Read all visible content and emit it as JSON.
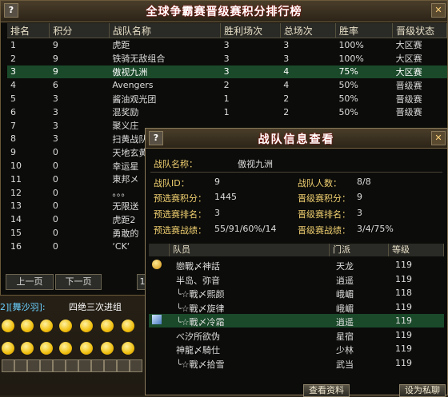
{
  "ranking": {
    "title": "全球争霸赛晋级赛积分排行榜",
    "headers": [
      "排名",
      "积分",
      "战队名称",
      "胜利场次",
      "总场次",
      "胜率",
      "晋级状态"
    ],
    "rows": [
      [
        "1",
        "9",
        "虎距",
        "3",
        "3",
        "100%",
        "大区赛"
      ],
      [
        "2",
        "9",
        "铁骑无敌组合",
        "3",
        "3",
        "100%",
        "大区赛"
      ],
      [
        "3",
        "9",
        "傲视九洲",
        "3",
        "4",
        "75%",
        "大区赛"
      ],
      [
        "4",
        "6",
        "Avengers",
        "2",
        "4",
        "50%",
        "晋级赛"
      ],
      [
        "5",
        "3",
        "酱油观光团",
        "1",
        "2",
        "50%",
        "晋级赛"
      ],
      [
        "6",
        "3",
        "混奖励",
        "1",
        "2",
        "50%",
        "晋级赛"
      ],
      [
        "7",
        "3",
        "聚义庄",
        "",
        "",
        "",
        ""
      ],
      [
        "8",
        "3",
        "扫黄战队",
        "",
        "",
        "",
        ""
      ],
      [
        "9",
        "0",
        "天地玄黄",
        "",
        "",
        "",
        ""
      ],
      [
        "10",
        "0",
        "幸运星",
        "",
        "",
        "",
        ""
      ],
      [
        "11",
        "0",
        "東邦メ",
        "",
        "",
        "",
        ""
      ],
      [
        "12",
        "0",
        "。。。",
        "",
        "",
        "",
        ""
      ],
      [
        "13",
        "0",
        "无限送",
        "",
        "",
        "",
        ""
      ],
      [
        "14",
        "0",
        "虎距2",
        "",
        "",
        "",
        ""
      ],
      [
        "15",
        "0",
        "勇敢的",
        "",
        "",
        "",
        ""
      ],
      [
        "16",
        "0",
        "‘CK‘",
        "",
        "",
        "",
        ""
      ]
    ],
    "selected_index": 2,
    "prev_label": "上一页",
    "next_label": "下一页",
    "page_stub": "1"
  },
  "chat": {
    "user": "2][舞沙羽]:",
    "text": "四绝三次进组"
  },
  "team": {
    "title": "战队信息查看",
    "name_label": "战队名称：",
    "name_value": "傲视九洲",
    "id_label": "战队ID：",
    "id_value": "9",
    "size_label": "战队人数：",
    "size_value": "8/8",
    "pre_score_label": "预选赛积分：",
    "pre_score_value": "1445",
    "promo_score_label": "晋级赛积分：",
    "promo_score_value": "9",
    "pre_rank_label": "预选赛排名：",
    "pre_rank_value": "3",
    "promo_rank_label": "晋级赛排名：",
    "promo_rank_value": "3",
    "pre_record_label": "预选赛战绩：",
    "pre_record_value": "55/91/60%/14",
    "promo_record_label": "晋级赛战绩：",
    "promo_record_value": "3/4/75%",
    "member_headers": [
      "队员",
      "门派",
      "等级"
    ],
    "members": [
      {
        "name": "戀戰〆神話",
        "sect": "天龙",
        "level": "119"
      },
      {
        "name": "半岛、弥音",
        "sect": "逍遥",
        "level": "119"
      },
      {
        "name": "╰☆戰〆熙颜",
        "sect": "峨嵋",
        "level": "118"
      },
      {
        "name": "╰☆戰〆旋律",
        "sect": "峨嵋",
        "level": "119"
      },
      {
        "name": "╰☆戰〆冷霜",
        "sect": "逍遥",
        "level": "119"
      },
      {
        "name": "べ汐所欲伪",
        "sect": "星宿",
        "level": "119"
      },
      {
        "name": "神龍〆騎仕",
        "sect": "少林",
        "level": "119"
      },
      {
        "name": "╰☆戰〆拾雪",
        "sect": "武当",
        "level": "119"
      }
    ],
    "selected_member_index": 4,
    "view_button": "查看资料",
    "chat_button": "设为私聊"
  }
}
